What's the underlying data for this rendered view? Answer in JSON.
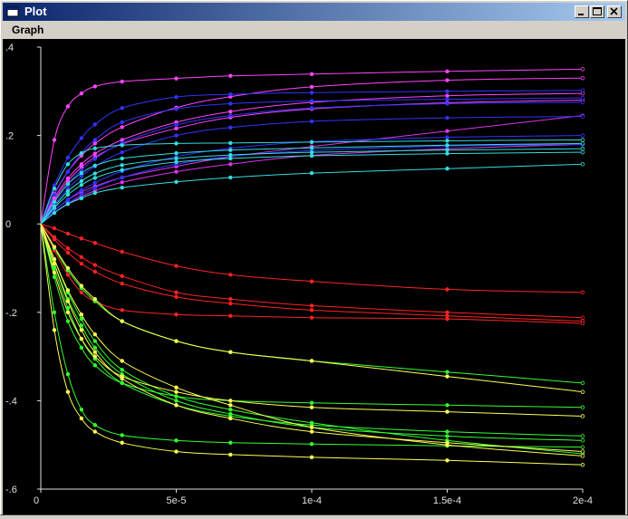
{
  "window": {
    "title": "Plot"
  },
  "menu": {
    "items": [
      "Graph"
    ]
  },
  "colors": {
    "titlebar_start": "#0a246a",
    "titlebar_end": "#a6caf0",
    "plot_background": "#000000",
    "axis": "#e0e0e0"
  },
  "icons": {
    "window": "window-icon",
    "minimize": "minimize-icon",
    "maximize": "maximize-icon",
    "close": "close-icon"
  },
  "chart_data": {
    "type": "line",
    "title": "",
    "xlabel": "",
    "ylabel": "",
    "xlim": [
      0,
      0.0002
    ],
    "ylim": [
      -0.6,
      0.4
    ],
    "x_ticks": [
      0,
      5e-05,
      0.0001,
      0.00015,
      0.0002
    ],
    "x_tick_labels": [
      "0",
      "5e-5",
      "1e-4",
      "1.5e-4",
      "2e-4"
    ],
    "y_ticks": [
      0.4,
      0.2,
      0,
      -0.2,
      -0.4,
      -0.6
    ],
    "y_tick_labels": [
      ".4",
      ".2",
      "0",
      "-.2",
      "-.4",
      "-.6"
    ],
    "grid": false,
    "legend": "none",
    "x": [
      0,
      5e-06,
      1e-05,
      1.5e-05,
      2e-05,
      3e-05,
      5e-05,
      7e-05,
      0.0001,
      0.00015,
      0.0002
    ],
    "series": [
      {
        "color": "#ff44ff",
        "values": [
          0,
          0.19,
          0.266,
          0.295,
          0.311,
          0.322,
          0.329,
          0.335,
          0.339,
          0.345,
          0.35
        ]
      },
      {
        "color": "#ff44ff",
        "values": [
          0,
          0.068,
          0.118,
          0.154,
          0.182,
          0.219,
          0.263,
          0.288,
          0.31,
          0.325,
          0.33
        ]
      },
      {
        "color": "#ff44ff",
        "values": [
          0,
          0.059,
          0.103,
          0.135,
          0.159,
          0.19,
          0.23,
          0.254,
          0.275,
          0.29,
          0.295
        ]
      },
      {
        "color": "#ff44ff",
        "values": [
          0,
          0.054,
          0.097,
          0.128,
          0.151,
          0.181,
          0.216,
          0.241,
          0.26,
          0.274,
          0.28
        ]
      },
      {
        "color": "#dd33ee",
        "values": [
          0,
          0.03,
          0.054,
          0.072,
          0.085,
          0.105,
          0.13,
          0.152,
          0.175,
          0.21,
          0.245
        ]
      },
      {
        "color": "#dd33ee",
        "values": [
          0,
          0.025,
          0.045,
          0.062,
          0.075,
          0.094,
          0.118,
          0.135,
          0.155,
          0.17,
          0.18
        ]
      },
      {
        "color": "#3333ff",
        "values": [
          0,
          0.087,
          0.15,
          0.194,
          0.225,
          0.262,
          0.287,
          0.293,
          0.297,
          0.3,
          0.302
        ]
      },
      {
        "color": "#3333ff",
        "values": [
          0,
          0.066,
          0.118,
          0.16,
          0.19,
          0.23,
          0.26,
          0.272,
          0.278,
          0.282,
          0.285
        ]
      },
      {
        "color": "#3333ff",
        "values": [
          0,
          0.05,
          0.09,
          0.122,
          0.147,
          0.183,
          0.224,
          0.245,
          0.262,
          0.272,
          0.275
        ]
      },
      {
        "color": "#3333ff",
        "values": [
          0,
          0.044,
          0.08,
          0.108,
          0.13,
          0.162,
          0.2,
          0.218,
          0.232,
          0.24,
          0.243
        ]
      },
      {
        "color": "#3333ff",
        "values": [
          0,
          0.03,
          0.055,
          0.076,
          0.093,
          0.119,
          0.152,
          0.171,
          0.186,
          0.196,
          0.2
        ]
      },
      {
        "color": "#3333ff",
        "values": [
          0,
          0.025,
          0.047,
          0.066,
          0.081,
          0.105,
          0.135,
          0.153,
          0.166,
          0.176,
          0.18
        ]
      },
      {
        "color": "#33dddd",
        "values": [
          0,
          0.08,
          0.135,
          0.16,
          0.171,
          0.178,
          0.182,
          0.183,
          0.185,
          0.188,
          0.19
        ]
      },
      {
        "color": "#33dddd",
        "values": [
          0,
          0.05,
          0.09,
          0.115,
          0.132,
          0.148,
          0.16,
          0.167,
          0.172,
          0.178,
          0.182
        ]
      },
      {
        "color": "#33dddd",
        "values": [
          0,
          0.04,
          0.074,
          0.097,
          0.114,
          0.133,
          0.148,
          0.156,
          0.162,
          0.167,
          0.17
        ]
      },
      {
        "color": "#33dddd",
        "values": [
          0,
          0.036,
          0.066,
          0.088,
          0.104,
          0.122,
          0.14,
          0.148,
          0.154,
          0.159,
          0.162
        ]
      },
      {
        "color": "#33dddd",
        "values": [
          0,
          0.025,
          0.045,
          0.058,
          0.07,
          0.082,
          0.095,
          0.105,
          0.115,
          0.125,
          0.135
        ]
      },
      {
        "color": "#ff2222",
        "values": [
          0,
          -0.01,
          -0.022,
          -0.033,
          -0.043,
          -0.063,
          -0.095,
          -0.115,
          -0.13,
          -0.148,
          -0.155
        ]
      },
      {
        "color": "#ff2222",
        "values": [
          0,
          -0.03,
          -0.055,
          -0.075,
          -0.093,
          -0.118,
          -0.155,
          -0.17,
          -0.185,
          -0.2,
          -0.212
        ]
      },
      {
        "color": "#ff2222",
        "values": [
          0,
          -0.035,
          -0.065,
          -0.09,
          -0.108,
          -0.135,
          -0.165,
          -0.18,
          -0.195,
          -0.208,
          -0.22
        ]
      },
      {
        "color": "#ff2222",
        "values": [
          0,
          -0.06,
          -0.115,
          -0.155,
          -0.175,
          -0.195,
          -0.205,
          -0.208,
          -0.212,
          -0.215,
          -0.225
        ]
      },
      {
        "color": "#33ff33",
        "values": [
          0,
          -0.055,
          -0.105,
          -0.145,
          -0.175,
          -0.22,
          -0.265,
          -0.29,
          -0.31,
          -0.335,
          -0.36
        ]
      },
      {
        "color": "#33ff33",
        "values": [
          0,
          -0.12,
          -0.22,
          -0.28,
          -0.32,
          -0.36,
          -0.39,
          -0.4,
          -0.405,
          -0.41,
          -0.415
        ]
      },
      {
        "color": "#33ff33",
        "values": [
          0,
          -0.2,
          -0.34,
          -0.42,
          -0.455,
          -0.478,
          -0.49,
          -0.495,
          -0.498,
          -0.502,
          -0.505
        ]
      },
      {
        "color": "#33ff33",
        "values": [
          0,
          -0.1,
          -0.19,
          -0.26,
          -0.305,
          -0.36,
          -0.41,
          -0.435,
          -0.455,
          -0.47,
          -0.48
        ]
      },
      {
        "color": "#33ff33",
        "values": [
          0,
          -0.09,
          -0.17,
          -0.23,
          -0.28,
          -0.34,
          -0.4,
          -0.43,
          -0.46,
          -0.48,
          -0.49
        ]
      },
      {
        "color": "#33ff33",
        "values": [
          0,
          -0.08,
          -0.155,
          -0.215,
          -0.265,
          -0.33,
          -0.39,
          -0.42,
          -0.45,
          -0.49,
          -0.52
        ]
      },
      {
        "color": "#ffff55",
        "values": [
          0,
          -0.052,
          -0.1,
          -0.14,
          -0.17,
          -0.22,
          -0.265,
          -0.29,
          -0.31,
          -0.345,
          -0.38
        ]
      },
      {
        "color": "#ffff55",
        "values": [
          0,
          -0.11,
          -0.2,
          -0.26,
          -0.3,
          -0.345,
          -0.38,
          -0.4,
          -0.415,
          -0.425,
          -0.435
        ]
      },
      {
        "color": "#ffff55",
        "values": [
          0,
          -0.24,
          -0.38,
          -0.44,
          -0.47,
          -0.495,
          -0.515,
          -0.522,
          -0.528,
          -0.535,
          -0.545
        ]
      },
      {
        "color": "#ffff55",
        "values": [
          0,
          -0.09,
          -0.175,
          -0.24,
          -0.29,
          -0.35,
          -0.41,
          -0.44,
          -0.47,
          -0.495,
          -0.515
        ]
      },
      {
        "color": "#ffff55",
        "values": [
          0,
          -0.08,
          -0.15,
          -0.205,
          -0.25,
          -0.31,
          -0.37,
          -0.41,
          -0.46,
          -0.5,
          -0.525
        ]
      }
    ]
  }
}
